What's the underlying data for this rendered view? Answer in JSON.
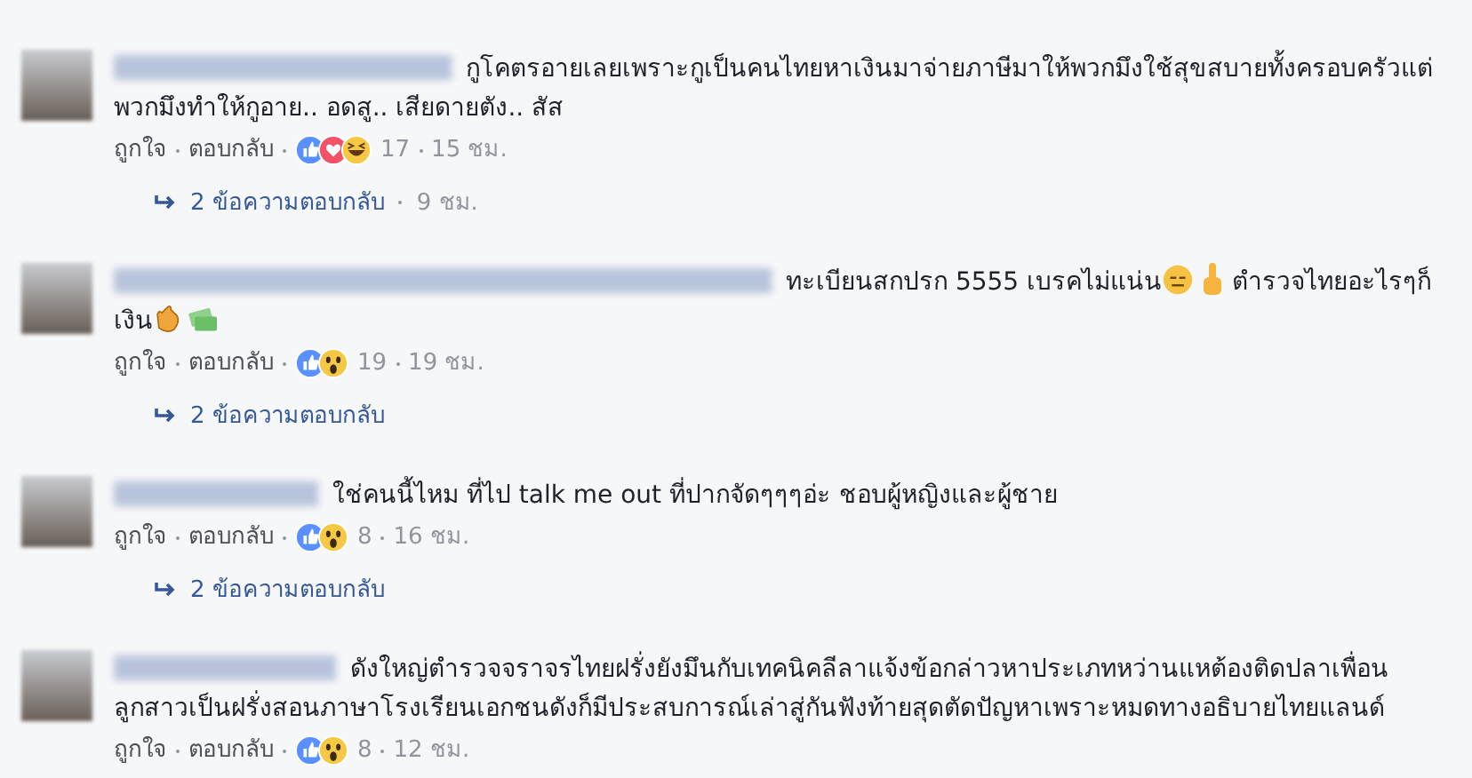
{
  "comments": [
    {
      "body": [
        {
          "kind": "text",
          "text": "กูโคตรอายเลยเพราะกูเป็นคนไทยหาเงินมาจ่ายภาษีมาให้พวกมึงใช้สุขสบายทั้งครอบครัวแต่พวกมึงทำให้กูอาย.. อดสู.. เสียดายตัง.. สัส"
        }
      ],
      "like": "ถูกใจ",
      "reply": "ตอบกลับ",
      "reactions": [
        {
          "kind": "like"
        },
        {
          "kind": "love"
        },
        {
          "kind": "haha"
        }
      ],
      "count": "17",
      "time": "15 ชม.",
      "replies": "2 ข้อความตอบกลับ",
      "replies_time": "9 ชม."
    },
    {
      "body": [
        {
          "kind": "text",
          "text": "ทะเบียนสกปรก 5555 เบรคไม่แน่น"
        },
        {
          "kind": "face"
        },
        {
          "kind": "finger"
        },
        {
          "kind": "text",
          "text": " ตำรวจไทยอะไรๆก็เงิน"
        },
        {
          "kind": "clap"
        },
        {
          "kind": "money"
        }
      ],
      "like": "ถูกใจ",
      "reply": "ตอบกลับ",
      "reactions": [
        {
          "kind": "like"
        },
        {
          "kind": "wow"
        }
      ],
      "count": "19",
      "time": "19 ชม.",
      "replies": "2 ข้อความตอบกลับ"
    },
    {
      "body": [
        {
          "kind": "text",
          "text": "ใช่คนนี้ไหม ที่ไป talk me out ที่ปากจัดๆๆๆอ่ะ ชอบผู้หญิงและผู้ชาย"
        }
      ],
      "like": "ถูกใจ",
      "reply": "ตอบกลับ",
      "reactions": [
        {
          "kind": "like"
        },
        {
          "kind": "wow"
        }
      ],
      "count": "8",
      "time": "16 ชม.",
      "replies": "2 ข้อความตอบกลับ"
    },
    {
      "body": [
        {
          "kind": "text",
          "text": "ดังใหญ่ตำรวจจราจรไทยฝรั่งยังมึนกับเทคนิคลีลาแจ้งข้อกล่าวหาประเภทหว่านแหต้องติดปลาเพื่อนลูกสาวเป็นฝรั่งสอนภาษาโรงเรียนเอกชนดังก็มีประสบการณ์เล่าสู่กันฟังท้ายสุดตัดปัญหาเพราะหมดทางอธิบายไทยแลนด์"
        }
      ],
      "like": "ถูกใจ",
      "reply": "ตอบกลับ",
      "reactions": [
        {
          "kind": "like"
        },
        {
          "kind": "wow"
        }
      ],
      "count": "8",
      "time": "12 ชม."
    }
  ]
}
